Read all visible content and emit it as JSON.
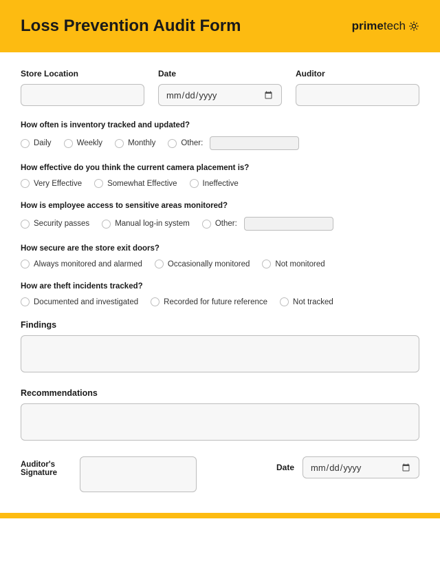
{
  "header": {
    "title": "Loss Prevention Audit Form",
    "brand_prime": "prime",
    "brand_tech": "tech"
  },
  "top": {
    "store_label": "Store Location",
    "date_label": "Date",
    "date_placeholder": "mm/dd/yyyy",
    "auditor_label": "Auditor"
  },
  "q1": {
    "label": "How often is inventory tracked and updated?",
    "o1": "Daily",
    "o2": "Weekly",
    "o3": "Monthly",
    "o4": "Other:"
  },
  "q2": {
    "label": "How effective do you think the current camera placement is?",
    "o1": "Very Effective",
    "o2": "Somewhat Effective",
    "o3": "Ineffective"
  },
  "q3": {
    "label": "How is employee access to sensitive areas monitored?",
    "o1": "Security passes",
    "o2": "Manual log-in system",
    "o3": "Other:"
  },
  "q4": {
    "label": "How secure are the store exit doors?",
    "o1": "Always monitored and alarmed",
    "o2": "Occasionally monitored",
    "o3": "Not monitored"
  },
  "q5": {
    "label": "How are theft incidents tracked?",
    "o1": "Documented and investigated",
    "o2": "Recorded for future reference",
    "o3": "Not tracked"
  },
  "findings_label": "Findings",
  "recommendations_label": "Recommendations",
  "sig": {
    "label": "Auditor's Signature",
    "date_label": "Date",
    "date_placeholder": "mm/dd/yyyy"
  }
}
